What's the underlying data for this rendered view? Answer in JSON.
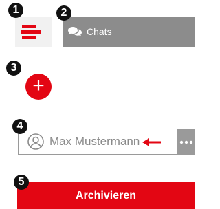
{
  "callouts": [
    "1",
    "2",
    "3",
    "4",
    "5"
  ],
  "header": {
    "chats_label": "Chats"
  },
  "contact": {
    "name": "Max Mustermann"
  },
  "actions": {
    "archive_label": "Archivieren"
  },
  "colors": {
    "accent": "#e30613",
    "gray": "#8c8c8c",
    "tile": "#f1f1f1"
  }
}
